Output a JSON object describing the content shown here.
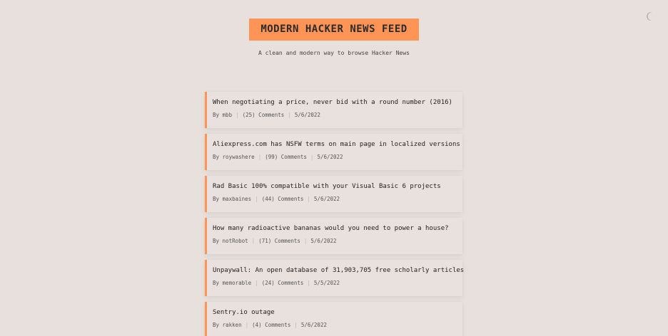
{
  "header": {
    "title": "MODERN HACKER NEWS FEED",
    "subtitle": "A clean and modern way to browse Hacker News"
  },
  "theme_toggle": {
    "icon": "moon-icon"
  },
  "stories": [
    {
      "title": "When negotiating a price, never bid with a round number (2016)",
      "author": "By mbb",
      "comments": "(25) Comments",
      "date": "5/6/2022"
    },
    {
      "title": "Aliexpress.com has NSFW terms on main page in localized versions",
      "author": "By roywashere",
      "comments": "(99) Comments",
      "date": "5/6/2022"
    },
    {
      "title": "Rad Basic 100% compatible with your Visual Basic 6 projects",
      "author": "By maxbaines",
      "comments": "(44) Comments",
      "date": "5/6/2022"
    },
    {
      "title": "How many radioactive bananas would you need to power a house?",
      "author": "By notRobot",
      "comments": "(71) Comments",
      "date": "5/6/2022"
    },
    {
      "title": "Unpaywall: An open database of 31,903,705 free scholarly articles",
      "author": "By memorable",
      "comments": "(24) Comments",
      "date": "5/5/2022"
    },
    {
      "title": "Sentry.io outage",
      "author": "By rakken",
      "comments": "(4) Comments",
      "date": "5/6/2022"
    }
  ],
  "colors": {
    "background": "#e8e0dc",
    "accent": "#ff9457"
  }
}
